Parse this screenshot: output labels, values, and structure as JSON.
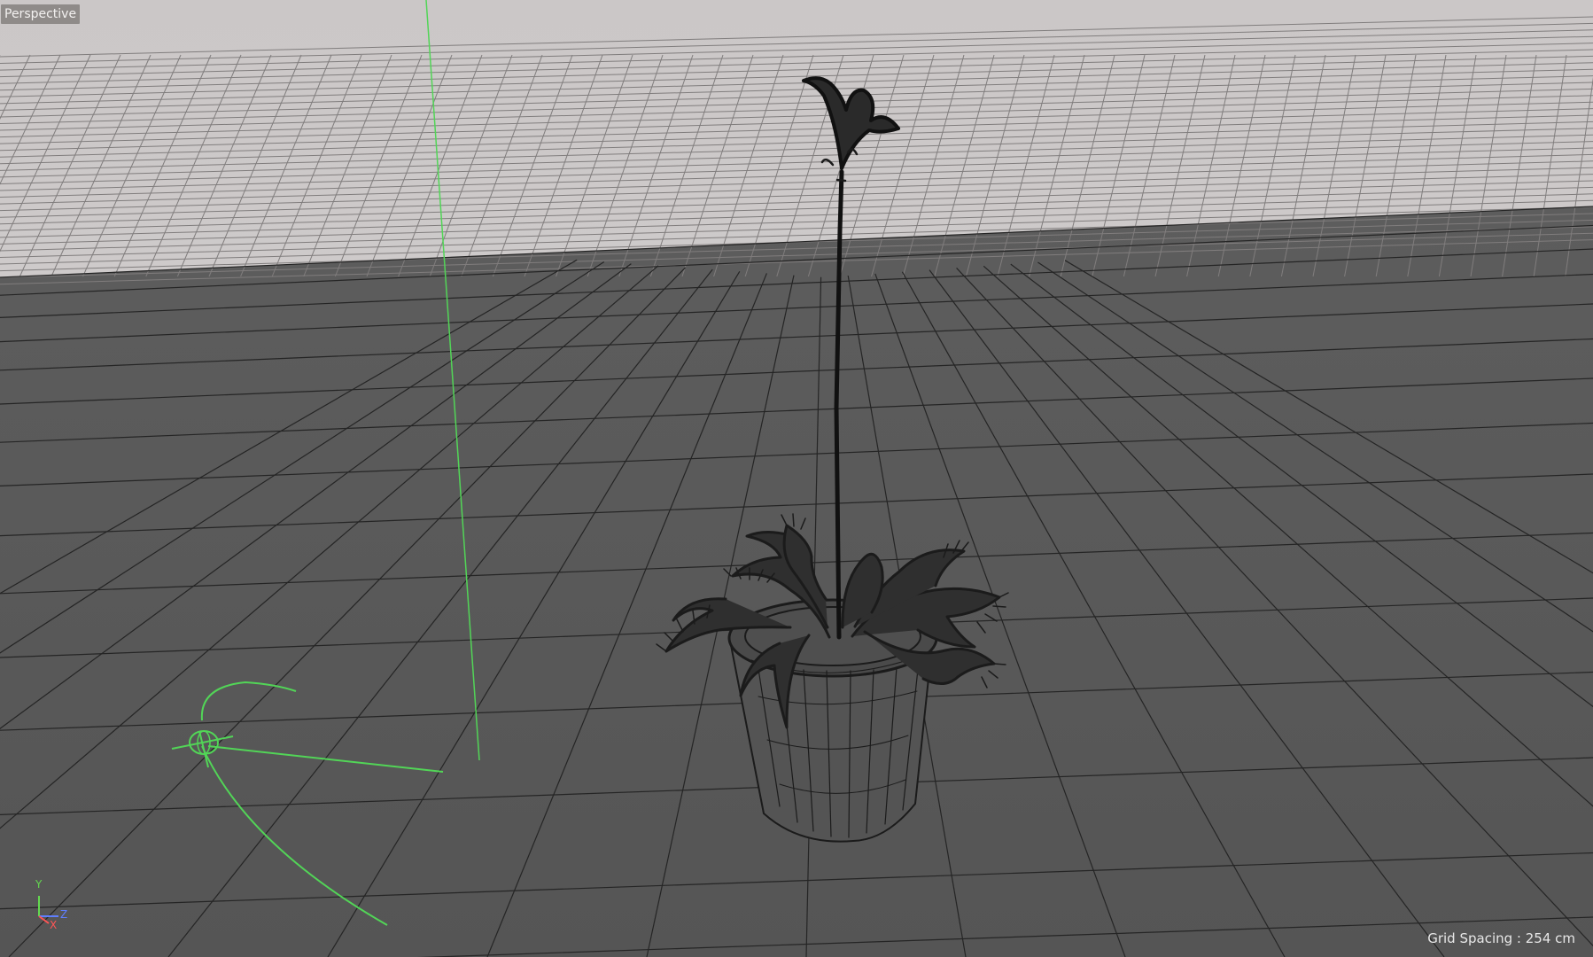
{
  "viewport": {
    "view_name": "Perspective",
    "grid_spacing_text": "Grid Spacing : 254 cm"
  },
  "axis_gizmo": {
    "labels": [
      "Y",
      "Z",
      "X"
    ],
    "colors": {
      "y": "#63d94f",
      "z": "#5f7fff",
      "x": "#ff5555"
    }
  },
  "colors": {
    "sky": "#c9c5c5",
    "floor": "#585858",
    "grid_line": "#232323",
    "distant_grid_line": "#7e7c7c",
    "camera_spline": "#52d557"
  }
}
